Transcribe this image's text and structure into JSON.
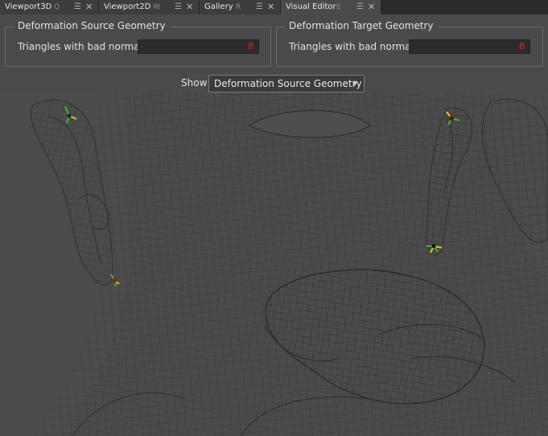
{
  "tabs": [
    {
      "label": "Viewport3D",
      "key": "Q",
      "active": false
    },
    {
      "label": "Viewport2D",
      "key": "W",
      "active": false
    },
    {
      "label": "Gallery",
      "key": "R",
      "active": false
    },
    {
      "label": "Visual Editor",
      "key": "E",
      "active": true
    }
  ],
  "source_group": {
    "title": "Deformation Source Geometry",
    "label": "Triangles with bad normals",
    "value": "8"
  },
  "target_group": {
    "title": "Deformation Target Geometry",
    "label": "Triangles with bad normals",
    "value": "8"
  },
  "show": {
    "label": "Show",
    "selected": "Deformation Source Geometry"
  },
  "icons": {
    "tab_menu": "hamburger-menu-icon",
    "tab_close": "close-icon",
    "dropdown": "dropdown-arrow-icon",
    "marker": "normal-marker-icon"
  },
  "colors": {
    "error_value": "#e0241a",
    "marker_green": "#2fbf2f",
    "marker_yellow": "#e8c21a",
    "wireframe": "#2c2c2c"
  }
}
